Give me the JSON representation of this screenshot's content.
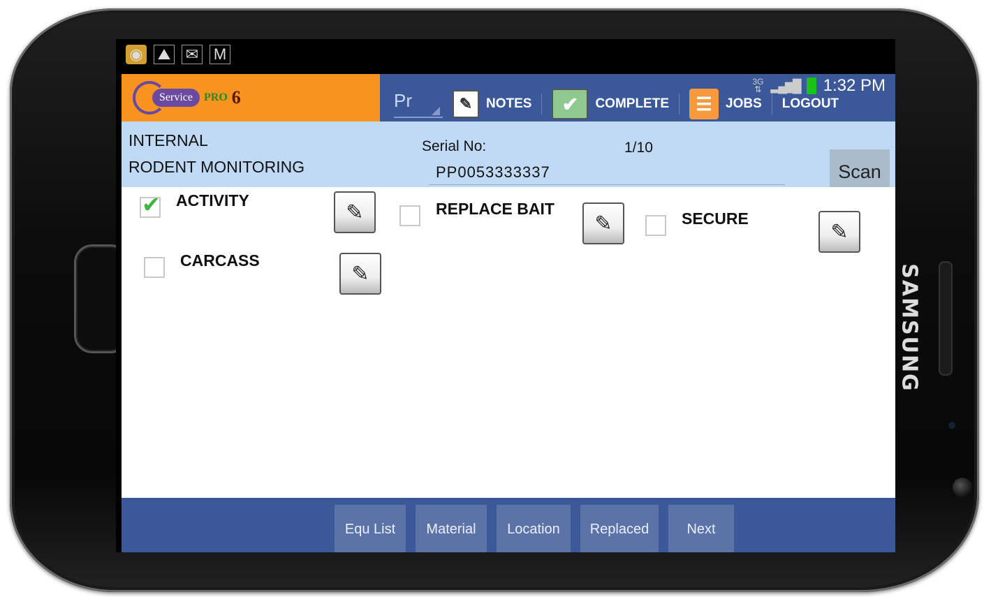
{
  "device": {
    "brand": "SAMSUNG"
  },
  "status_bar": {
    "network": "3G",
    "time": "1:32 PM",
    "notification_icons": [
      "servicepro-app-icon",
      "image-icon",
      "email-error-icon",
      "gmail-icon"
    ]
  },
  "app": {
    "logo": {
      "service": "Service",
      "pro": "PRO",
      "version": "6"
    }
  },
  "toolbar": {
    "dropdown_value": "Pr",
    "notes_label": "NOTES",
    "complete_label": "COMPLETE",
    "jobs_label": "JOBS",
    "logout_label": "LOGOUT"
  },
  "info": {
    "line1": "INTERNAL",
    "line2": "RODENT MONITORING",
    "serial_label": "Serial No:",
    "serial_value": "PP0053333337",
    "counter": "1/10",
    "scan_label": "Scan"
  },
  "checklist": [
    {
      "label": "ACTIVITY",
      "checked": true
    },
    {
      "label": "REPLACE BAIT",
      "checked": false
    },
    {
      "label": "SECURE",
      "checked": false
    },
    {
      "label": "CARCASS",
      "checked": false
    }
  ],
  "bottom_bar": {
    "buttons": [
      "Equ List",
      "Material",
      "Location",
      "Replaced",
      "Next"
    ]
  },
  "colors": {
    "header_blue": "#3b5898",
    "logo_orange": "#f7931e",
    "info_light_blue": "#c0daf5",
    "check_green": "#3fb53f"
  }
}
